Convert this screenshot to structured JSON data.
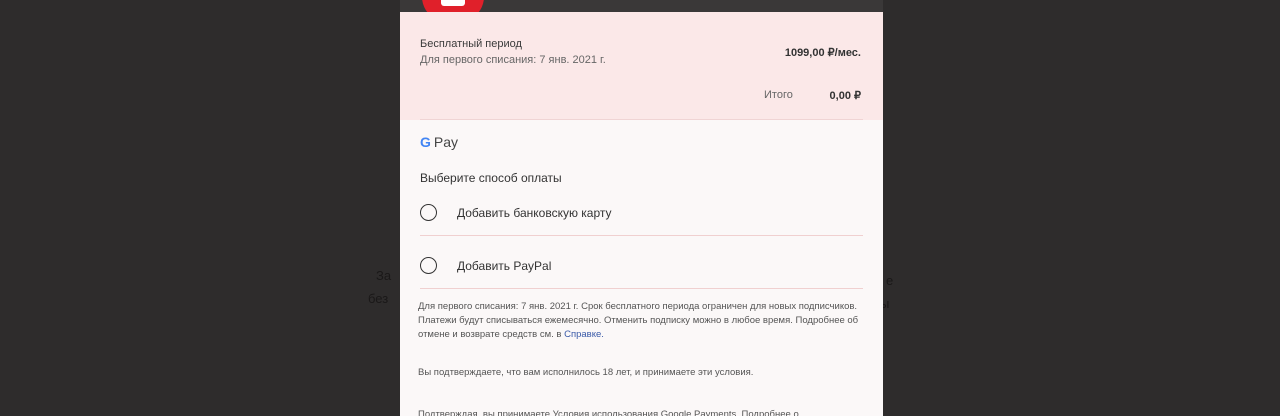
{
  "backdrop": {
    "left_line_1": "За",
    "left_line_2": "без",
    "right_line_1": "е",
    "right_line_2": "ы"
  },
  "summary": {
    "title": "Бесплатный период",
    "subtitle": "Для первого списания: 7 янв. 2021 г.",
    "price": "1099,00 ₽/мес.",
    "tax_label": "Итого",
    "tax_value": "0,00 ₽"
  },
  "gpay": {
    "label": "Pay"
  },
  "payment": {
    "section_title": "Выберите способ оплаты",
    "options": [
      {
        "label": "Добавить банковскую карту"
      },
      {
        "label": "Добавить PayPal"
      }
    ]
  },
  "legal": {
    "paragraph_1": "Для первого списания: 7 янв. 2021 г. Срок бесплатного периода ограничен для новых подписчиков. Платежи будут списываться ежемесячно. Отменить подписку можно в любое время. Подробнее об отмене и возврате средств см. в",
    "paragraph_1_link": "Справке.",
    "paragraph_2": "Вы подтверждаете, что вам исполнилось 18 лет, и принимаете эти условия.",
    "paragraph_3": "Подтверждая, вы принимаете Условия использования Google Payments. Подробнее о"
  },
  "colors": {
    "backdrop": "#2e2c2c",
    "sheet": "#fbf8f8",
    "summary_bg": "#fbe8e8",
    "brand": "#e0202a",
    "link": "#3a5aa8"
  }
}
